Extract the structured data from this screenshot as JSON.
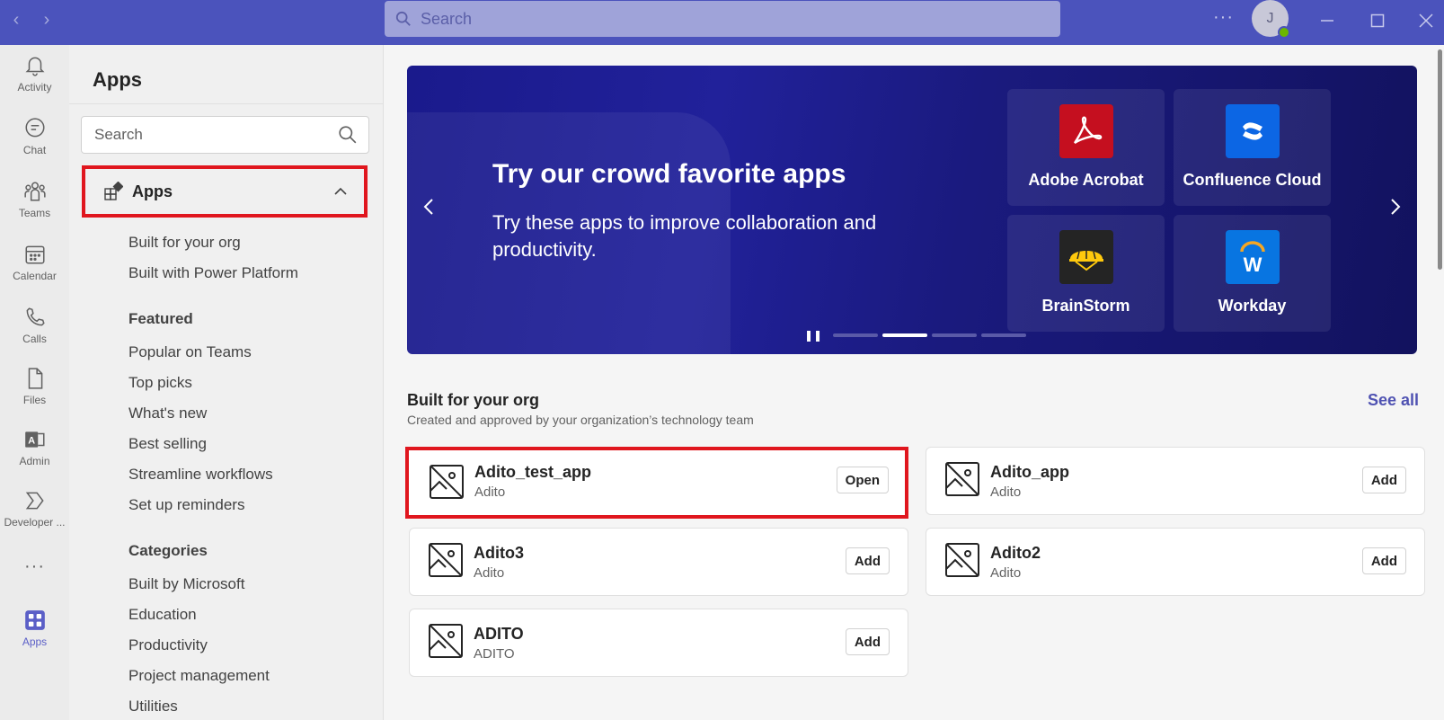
{
  "titlebar": {
    "search_placeholder": "Search",
    "more": "···",
    "avatar_initial": "J"
  },
  "rail": {
    "items": [
      {
        "label": "Activity",
        "icon": "bell-icon"
      },
      {
        "label": "Chat",
        "icon": "chat-icon"
      },
      {
        "label": "Teams",
        "icon": "teams-icon"
      },
      {
        "label": "Calendar",
        "icon": "calendar-icon"
      },
      {
        "label": "Calls",
        "icon": "phone-icon"
      },
      {
        "label": "Files",
        "icon": "file-icon"
      },
      {
        "label": "Admin",
        "icon": "admin-icon"
      },
      {
        "label": "Developer ...",
        "icon": "developer-icon"
      },
      {
        "label": "···",
        "icon": "more-icon"
      },
      {
        "label": "Apps",
        "icon": "apps-icon"
      }
    ]
  },
  "panel": {
    "title": "Apps",
    "search_placeholder": "Search",
    "section_label": "Apps",
    "links_top": [
      "Built for your org",
      "Built with Power Platform"
    ],
    "featured_head": "Featured",
    "featured": [
      "Popular on Teams",
      "Top picks",
      "What's new",
      "Best selling",
      "Streamline workflows",
      "Set up reminders"
    ],
    "categories_head": "Categories",
    "categories": [
      "Built by Microsoft",
      "Education",
      "Productivity",
      "Project management",
      "Utilities"
    ]
  },
  "hero": {
    "title": "Try our crowd favorite apps",
    "subtitle": "Try these apps to improve collaboration and productivity.",
    "tiles": [
      {
        "name": "Adobe Acrobat",
        "color": "#c50f1f"
      },
      {
        "name": "Confluence Cloud",
        "color": "#0c66e4"
      },
      {
        "name": "BrainStorm",
        "color": "#242424"
      },
      {
        "name": "Workday",
        "color": "#0875e1"
      }
    ],
    "active_slide": 2,
    "slide_count": 4
  },
  "built_for_org": {
    "title": "Built for your org",
    "subtitle": "Created and approved by your organization’s technology team",
    "see_all": "See all",
    "apps": [
      {
        "name": "Adito_test_app",
        "publisher": "Adito",
        "action": "Open"
      },
      {
        "name": "Adito_app",
        "publisher": "Adito",
        "action": "Add"
      },
      {
        "name": "Adito3",
        "publisher": "Adito",
        "action": "Add"
      },
      {
        "name": "Adito2",
        "publisher": "Adito",
        "action": "Add"
      },
      {
        "name": "ADITO",
        "publisher": "ADITO",
        "action": "Add"
      }
    ]
  },
  "colors": {
    "titlebar": "#4b53bc",
    "accent": "#5b5fc7",
    "highlight": "#e0161e"
  }
}
